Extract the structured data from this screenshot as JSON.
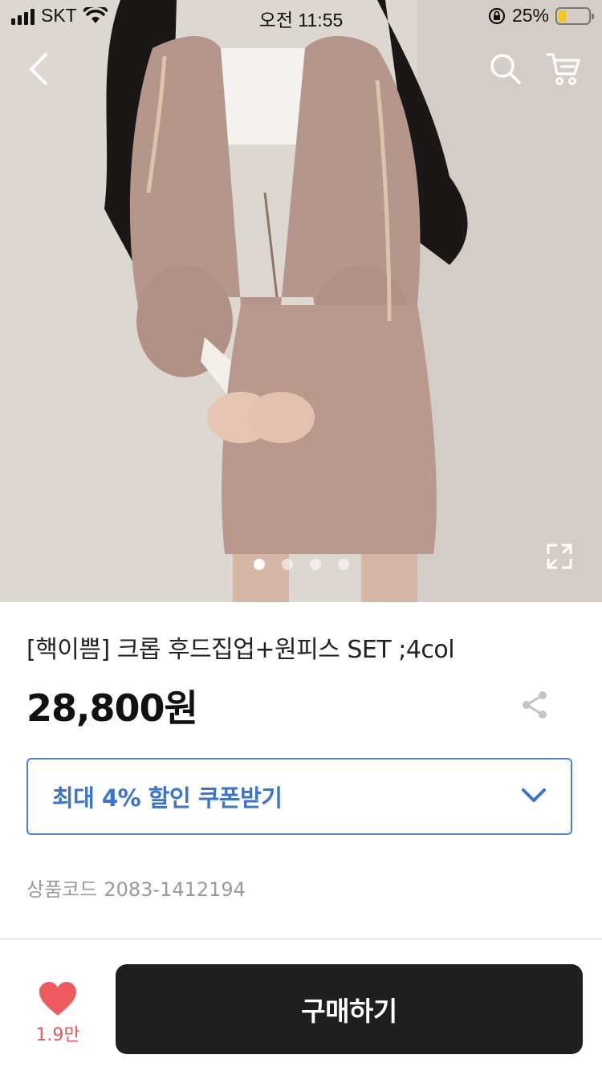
{
  "status_bar": {
    "carrier": "SKT",
    "time": "오전 11:55",
    "battery_percent": "25%",
    "battery_level": 0.25,
    "battery_color": "#f5c518"
  },
  "nav": {
    "back_icon": "chevron-left-icon",
    "search_icon": "search-icon",
    "cart_icon": "cart-icon"
  },
  "gallery": {
    "image": "product-photo",
    "total_slides": 4,
    "active_slide": 1,
    "expand_icon": "expand-icon"
  },
  "product": {
    "title": "[핵이쁨] 크롭 후드집업+원피스 SET ;4col",
    "price": "28,800원",
    "share_icon": "share-icon",
    "coupon_label": "최대 4% 할인 쿠폰받기",
    "coupon_color": "#3b73d1",
    "code_label": "상품코드",
    "code_value": "2083-1412194"
  },
  "bottom_bar": {
    "like_icon": "heart-icon",
    "like_count": "1.9만",
    "like_color": "#e8585a",
    "buy_label": "구매하기",
    "buy_color": "#1f1f1f"
  }
}
